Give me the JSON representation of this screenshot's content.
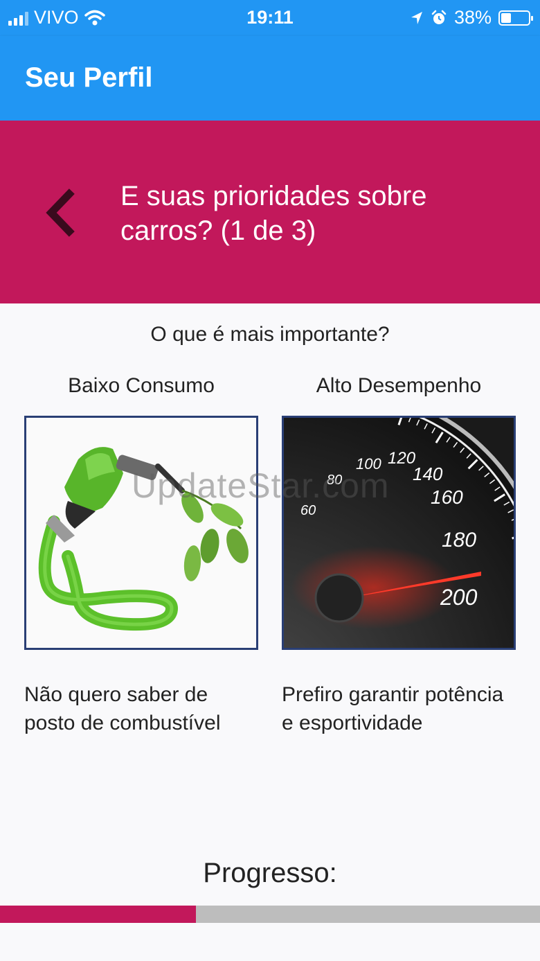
{
  "status_bar": {
    "carrier": "VIVO",
    "time": "19:11",
    "battery": "38%"
  },
  "app_bar": {
    "title": "Seu Perfil"
  },
  "banner": {
    "title": "E suas prioridades sobre carros? (1 de 3)"
  },
  "question": "O que é mais importante?",
  "options": [
    {
      "label": "Baixo Consumo",
      "description": "Não quero saber de posto de combustível",
      "image": "fuel-nozzle-leaves-image"
    },
    {
      "label": "Alto Desempenho",
      "description": "Prefiro garantir potência e esportividade",
      "image": "speedometer-image",
      "gauge_labels": [
        "60",
        "80",
        "100",
        "120",
        "140",
        "160",
        "180",
        "200"
      ]
    }
  ],
  "watermark": "UpdateStar.com",
  "progress": {
    "label": "Progresso:",
    "fraction": 0.3628
  },
  "colors": {
    "app_bar": "#2196f3",
    "banner": "#c2185b",
    "progress_fill": "#c2185b",
    "progress_track": "#bdbdbd",
    "image_border": "#2a3f75"
  }
}
